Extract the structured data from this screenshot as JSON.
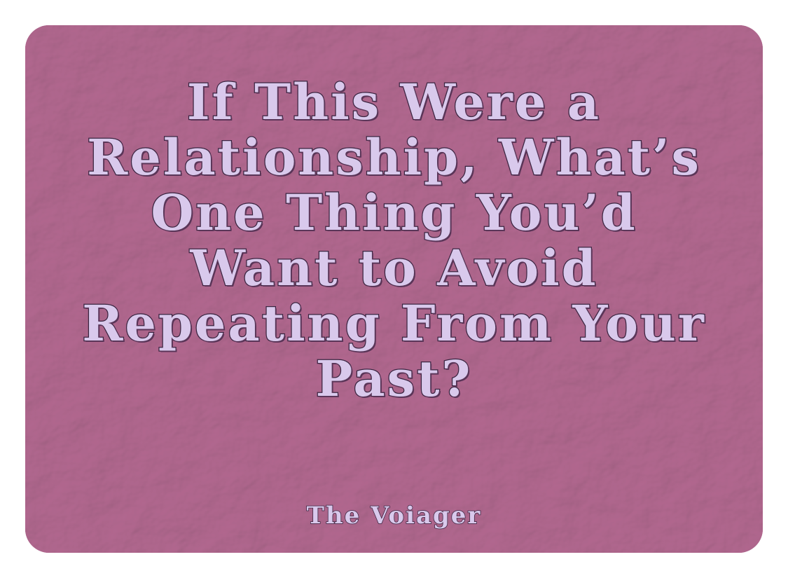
{
  "card": {
    "background_color": "#c27ea4",
    "text_color": "#d9c9ec",
    "outline_color": "#3a2440"
  },
  "headline": {
    "lines": [
      "If This Were a",
      "Relationship, What’s",
      "One Thing You’d",
      "Want to Avoid",
      "Repeating From Your",
      "Past?"
    ]
  },
  "byline": "The Voiager"
}
